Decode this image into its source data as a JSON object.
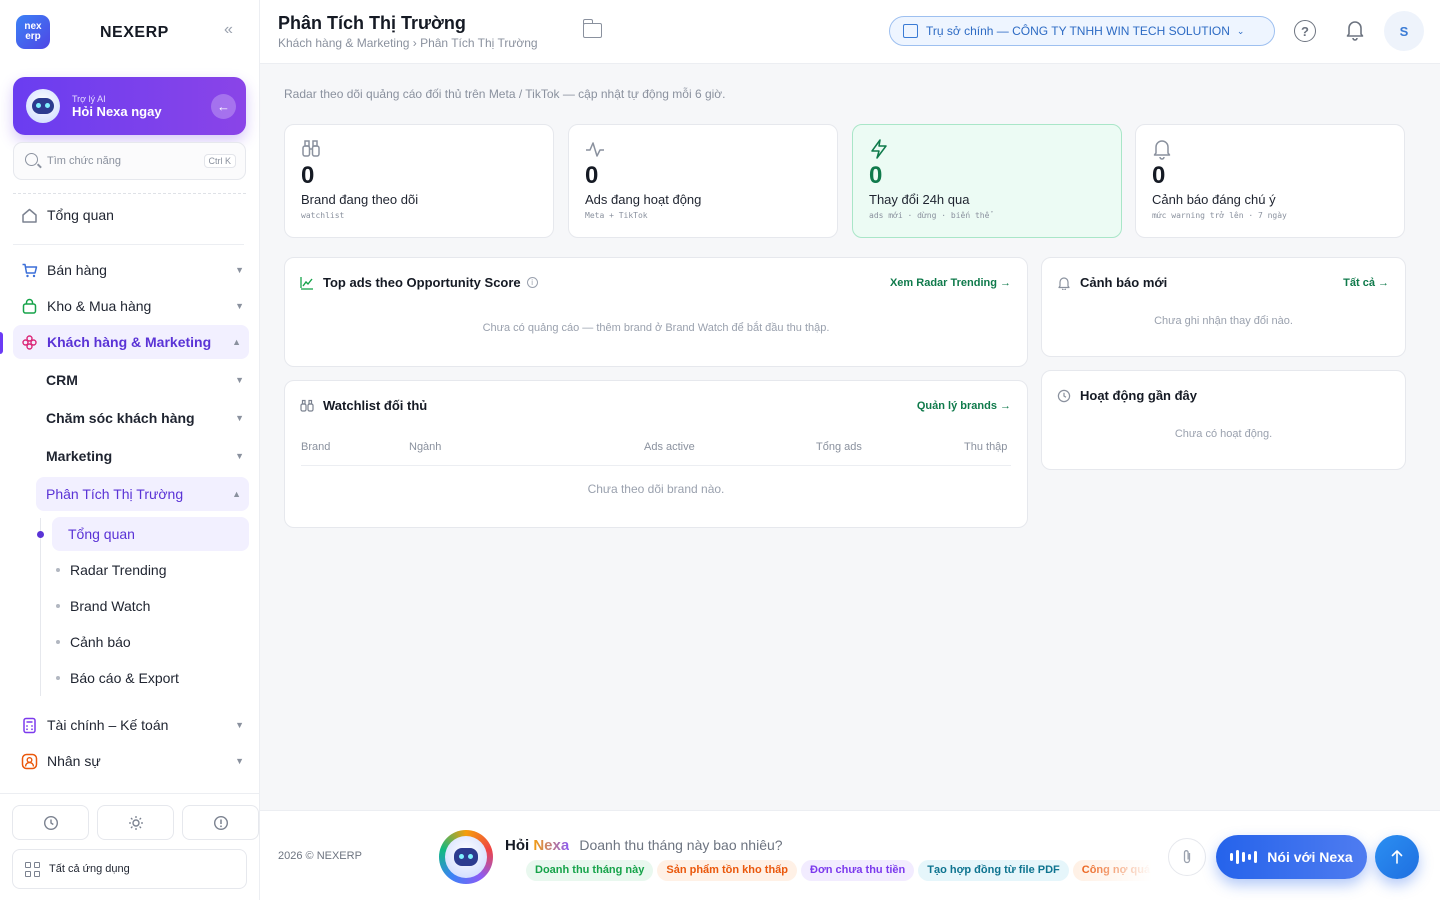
{
  "app": {
    "name": "NEXERP",
    "logo_text": "nex erp"
  },
  "ai_card": {
    "small": "Trợ lý AI",
    "big": "Hỏi Nexa ngay"
  },
  "search": {
    "placeholder": "Tìm chức năng",
    "shortcut": "Ctrl K"
  },
  "sidebar": {
    "overview": "Tổng quan",
    "sections": [
      {
        "label": "Bán hàng",
        "icon": "cart-icon"
      },
      {
        "label": "Kho & Mua hàng",
        "icon": "bag-icon"
      },
      {
        "label": "Khách hàng & Marketing",
        "icon": "flower-icon"
      }
    ],
    "sub": [
      "CRM",
      "Chăm sóc khách hàng",
      "Marketing",
      "Phân Tích Thị Trường"
    ],
    "leaves": [
      "Tổng quan",
      "Radar Trending",
      "Brand Watch",
      "Cảnh báo",
      "Báo cáo & Export"
    ],
    "more": [
      {
        "label": "Tài chính – Kế toán",
        "icon": "calculator-icon"
      },
      {
        "label": "Nhân sự",
        "icon": "person-icon"
      }
    ],
    "all_apps": "Tất cả ứng dụng"
  },
  "header": {
    "title": "Phân Tích Thị Trường",
    "breadcrumb": "Khách hàng & Marketing › Phân Tích Thị Trường",
    "company": "Trụ sở chính — CÔNG TY TNHH WIN TECH SOLUTION",
    "avatar_initial": "S",
    "help_glyph": "?"
  },
  "main": {
    "subtitle": "Radar theo dõi quảng cáo đối thủ trên Meta / TikTok — cập nhật tự động mỗi 6 giờ.",
    "stats": [
      {
        "value": "0",
        "label": "Brand đang theo dõi",
        "note": "watchlist",
        "icon": "binoculars-icon"
      },
      {
        "value": "0",
        "label": "Ads đang hoạt động",
        "note": "Meta + TikTok",
        "icon": "activity-icon"
      },
      {
        "value": "0",
        "label": "Thay đổi 24h qua",
        "note": "ads mới · dừng · biến thể",
        "icon": "lightning-icon"
      },
      {
        "value": "0",
        "label": "Cảnh báo đáng chú ý",
        "note": "mức warning trở lên · 7 ngày",
        "icon": "bell-icon"
      }
    ],
    "top_ads": {
      "title": "Top ads theo Opportunity Score",
      "link": "Xem Radar Trending →",
      "empty": "Chưa có quảng cáo — thêm brand ở Brand Watch để bắt đầu thu thập."
    },
    "watchlist": {
      "title": "Watchlist đối thủ",
      "link": "Quản lý brands →",
      "columns": [
        "Brand",
        "Ngành",
        "Ads active",
        "Tổng ads",
        "Thu thập"
      ],
      "empty": "Chưa theo dõi brand nào."
    },
    "alerts": {
      "title": "Cảnh báo mới",
      "link": "Tất cả →",
      "empty": "Chưa ghi nhận thay đổi nào."
    },
    "activity": {
      "title": "Hoạt động gần đây",
      "empty": "Chưa có hoạt động."
    }
  },
  "footer": {
    "copyright": "2026 © NEXERP",
    "ask_prefix": "Hỏi",
    "ask_brand": "Nexa",
    "ask_placeholder": "Doanh thu tháng này bao nhiêu?",
    "chips": [
      {
        "label": "Doanh thu tháng này",
        "color": "#16a34a",
        "bg": "#e9f8ef"
      },
      {
        "label": "Sản phẩm tồn kho thấp",
        "color": "#ea580c",
        "bg": "#fff1e6"
      },
      {
        "label": "Đơn chưa thu tiền",
        "color": "#7c3aed",
        "bg": "#f2ecff"
      },
      {
        "label": "Tạo hợp đồng từ file PDF",
        "color": "#0e7490",
        "bg": "#e6f6fb"
      },
      {
        "label": "Công nợ quá hạn",
        "color": "#ea580c",
        "bg": "#fff1e6"
      }
    ],
    "voice_label": "Nói với Nexa"
  },
  "colors": {
    "accent": "#6b3bf5",
    "success": "#0f7a4b",
    "link_blue": "#2d6bc4"
  }
}
